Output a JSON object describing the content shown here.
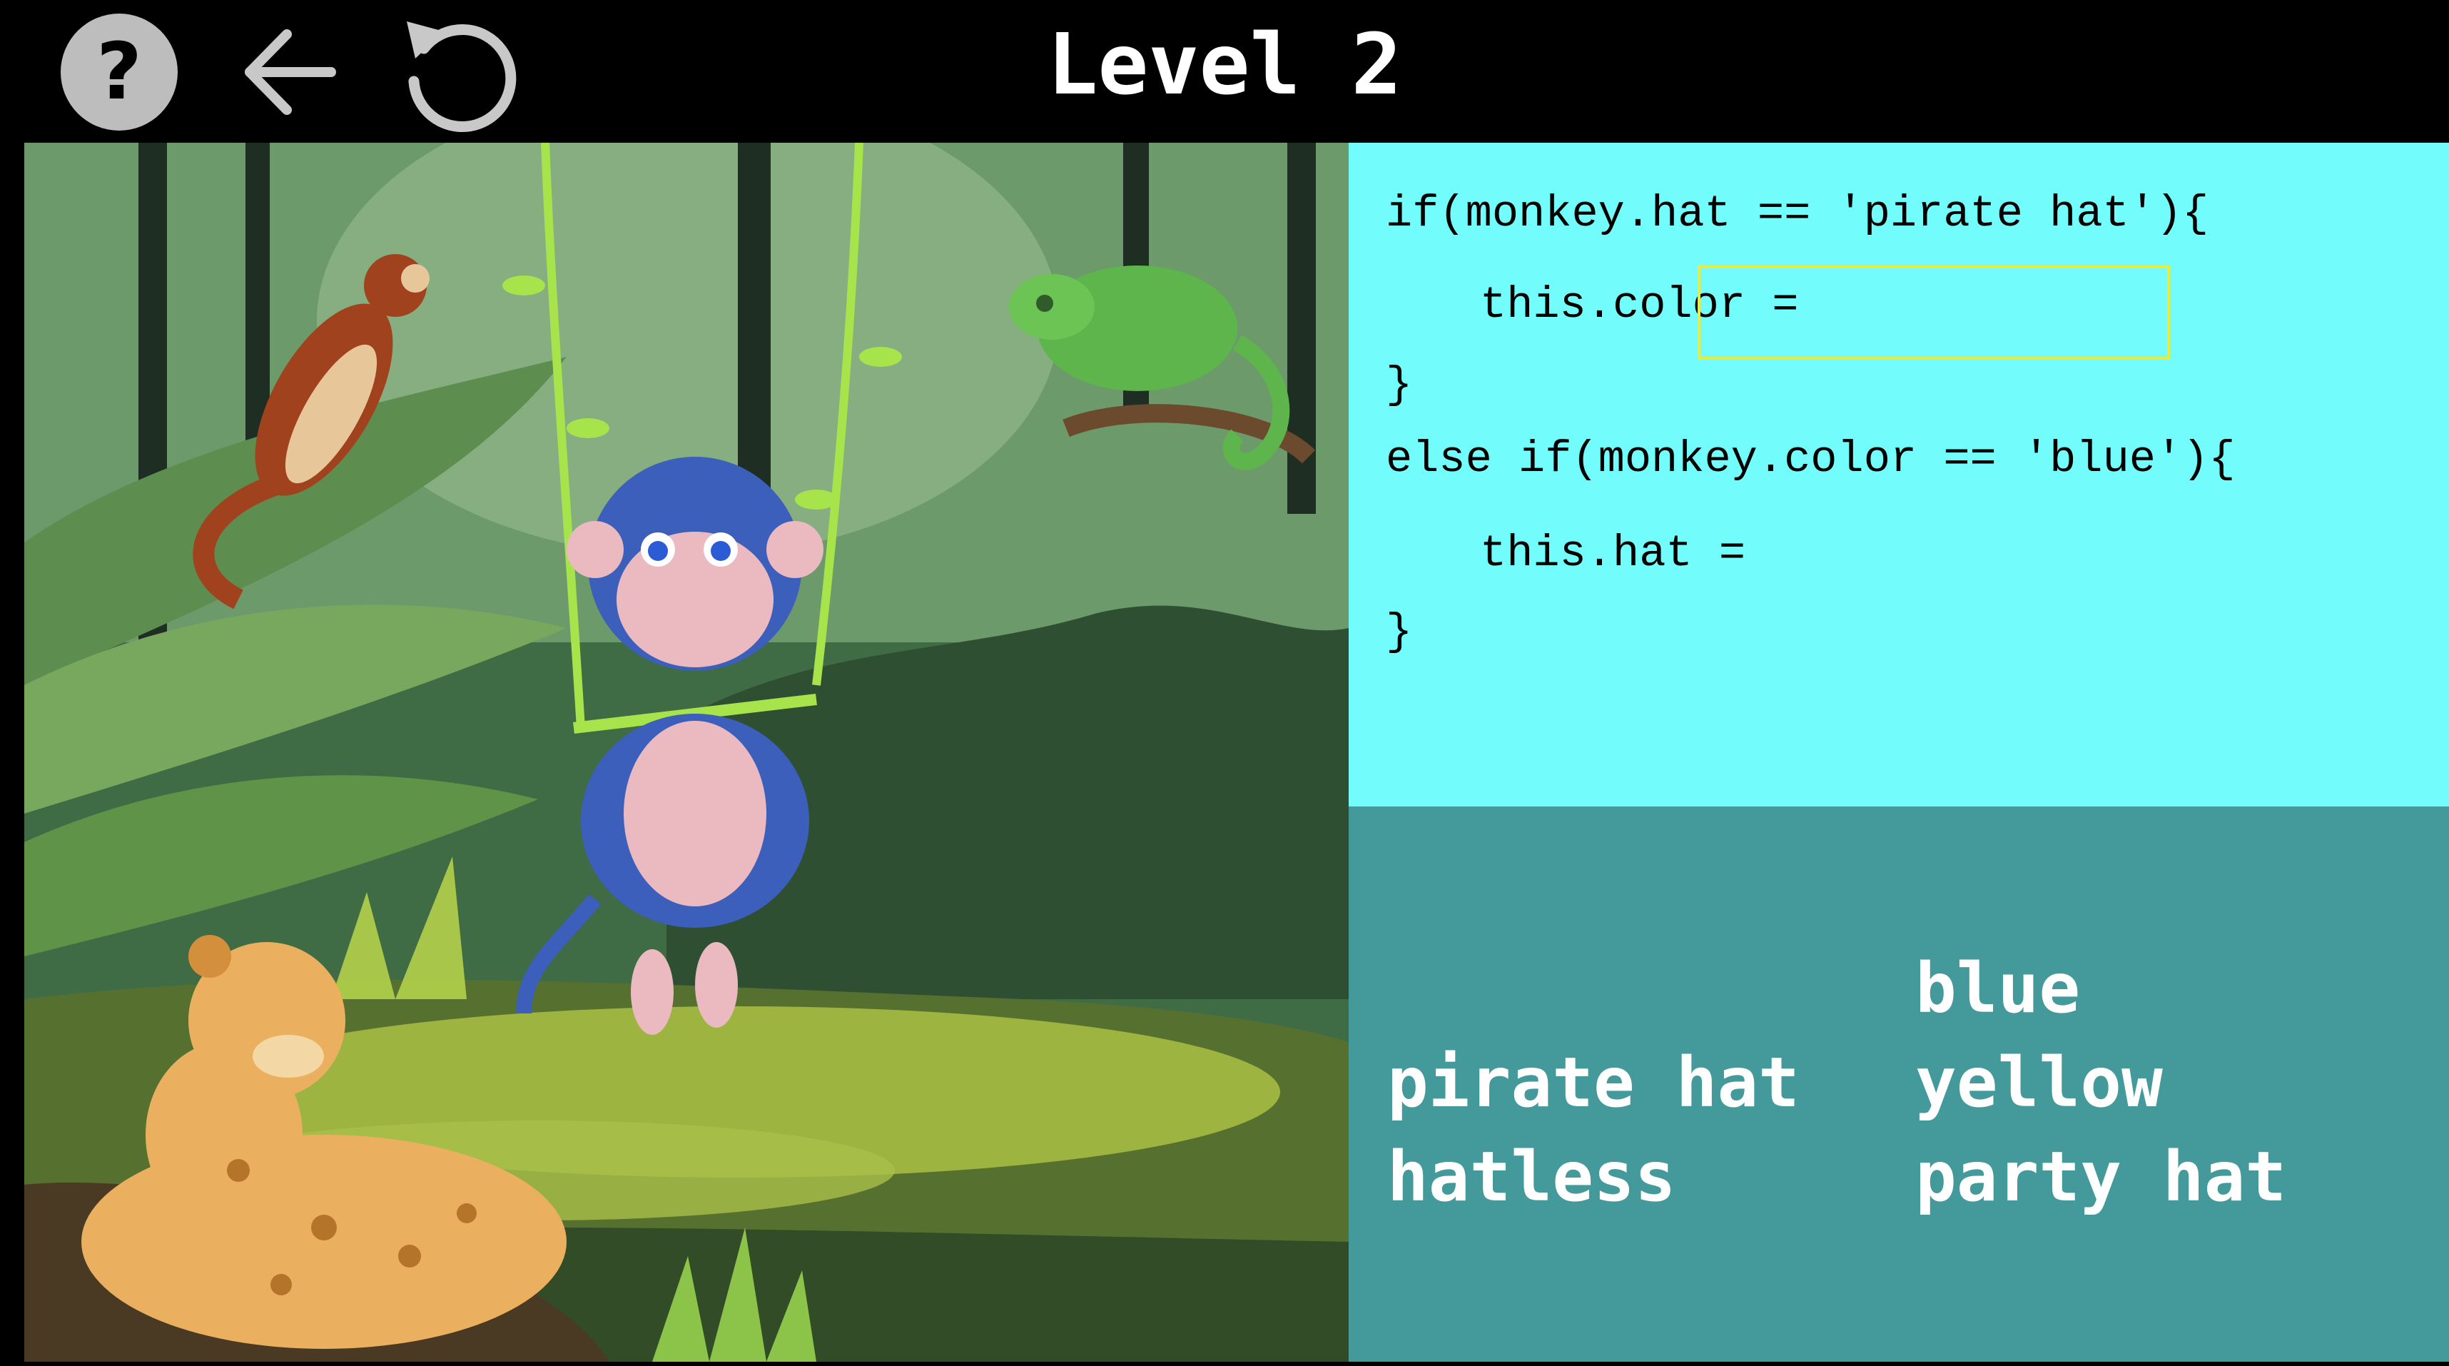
{
  "header": {
    "title": "Level 2",
    "help_label": "?",
    "help_icon": "question-circle-icon",
    "back_icon": "arrow-left-icon",
    "reset_icon": "rotate-ccw-icon"
  },
  "code": {
    "lines": [
      "if(monkey.hat == 'pirate hat'){",
      "this.color =",
      "}",
      "else if(monkey.color == 'blue'){",
      "this.hat =",
      "}"
    ],
    "blank_1_value": "",
    "blank_2_value": ""
  },
  "options": {
    "col1": [
      "pirate hat",
      "hatless"
    ],
    "col2": [
      "blue",
      "yellow",
      "party hat"
    ]
  },
  "colors": {
    "code_panel_bg": "#72fcfc",
    "options_panel_bg": "#449a9a",
    "blank_outline": "#e9ec3a",
    "topbar_bg": "#000000"
  },
  "scene": {
    "characters": [
      "monkey-on-swing",
      "jaguar",
      "chameleon",
      "tree-kangaroo"
    ]
  }
}
